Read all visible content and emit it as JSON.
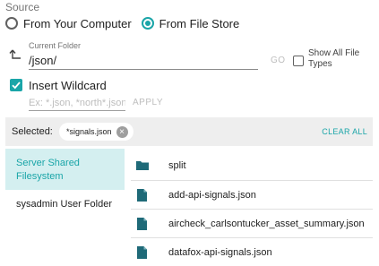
{
  "source": {
    "label": "Source",
    "options": [
      {
        "label": "From Your Computer",
        "selected": false
      },
      {
        "label": "From File Store",
        "selected": true
      }
    ]
  },
  "folder": {
    "caption": "Current Folder",
    "value": "/json/",
    "go_label": "GO",
    "show_all_label": "Show All File Types",
    "show_all_checked": false
  },
  "wildcard": {
    "label": "Insert Wildcard",
    "checked": true,
    "placeholder": "Ex: *.json, *north*.json",
    "apply_label": "APPLY"
  },
  "selected": {
    "label": "Selected:",
    "chips": [
      "*signals.json"
    ],
    "clear_all_label": "CLEAR ALL"
  },
  "sidebar": {
    "items": [
      {
        "label": "Server Shared Filesystem",
        "active": true
      },
      {
        "label": "sysadmin User Folder",
        "active": false
      }
    ]
  },
  "files": [
    {
      "name": "split",
      "type": "folder",
      "icon": "folder-icon"
    },
    {
      "name": "add-api-signals.json",
      "type": "file",
      "icon": "file-icon"
    },
    {
      "name": "aircheck_carlsontucker_asset_summary.json",
      "type": "file",
      "icon": "file-icon"
    },
    {
      "name": "datafox-api-signals.json",
      "type": "file",
      "icon": "file-icon"
    }
  ],
  "colors": {
    "accent": "#1aa5a8",
    "sidebar_active_bg": "#d4eff0",
    "selected_bar_bg": "#eeeeee",
    "icon_dark": "#1f6a78"
  }
}
